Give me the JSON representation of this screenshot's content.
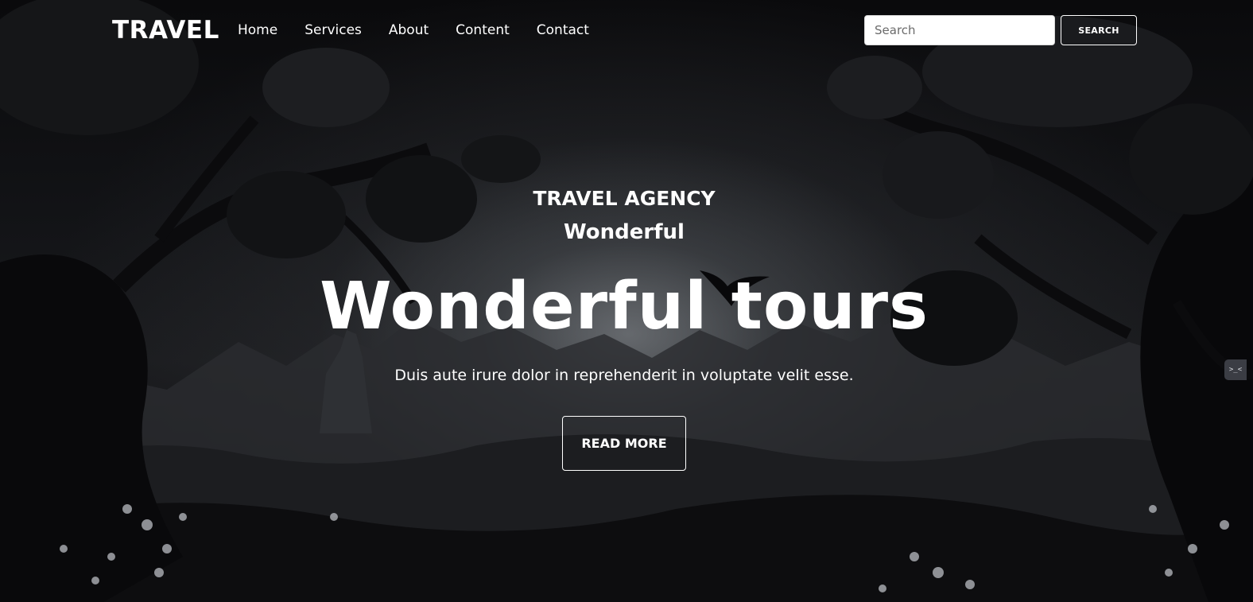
{
  "nav": {
    "brand": "TRAVEL",
    "links": [
      "Home",
      "Services",
      "About",
      "Content",
      "Contact"
    ],
    "search_placeholder": "Search",
    "search_button": "SEARCH"
  },
  "hero": {
    "kicker": "TRAVEL AGENCY",
    "sub_kicker": "Wonderful",
    "headline": "Wonderful tours",
    "tagline": "Duis aute irure dolor in reprehenderit in voluptate velit esse.",
    "cta": "READ MORE"
  },
  "colors": {
    "text": "#ffffff",
    "background": "#050506",
    "input_background": "#ffffff"
  },
  "icons": {
    "side_tab": "terminal-icon"
  }
}
